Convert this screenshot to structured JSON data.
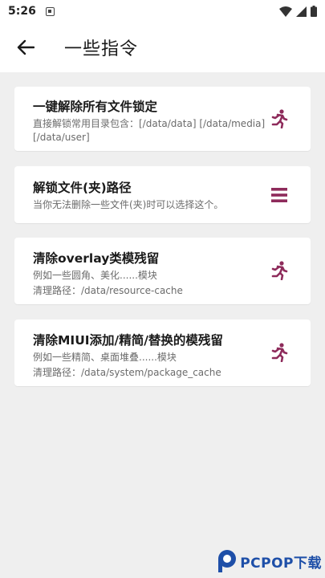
{
  "status_bar": {
    "time": "5:26",
    "notification_icon": "notification-a-icon",
    "wifi_icon": "wifi-icon",
    "signal_icon": "signal-icon",
    "battery_icon": "battery-icon"
  },
  "app_bar": {
    "back_icon": "arrow-back-icon",
    "title": "一些指令"
  },
  "accent_color": "#8e2b5b",
  "cards": [
    {
      "title": "一键解除所有文件锁定",
      "desc_lines": [
        "直接解锁常用目录包含：[/data/data] [/data/media]",
        "[/data/user]"
      ],
      "icon": "run-icon"
    },
    {
      "title": "解锁文件(夹)路径",
      "desc_lines": [
        "当你无法删除一些文件(夹)时可以选择这个。"
      ],
      "icon": "menu-icon"
    },
    {
      "title": "清除overlay类模残留",
      "desc_lines": [
        "例如一些圆角、美化......模块",
        "清理路径：/data/resource-cache"
      ],
      "icon": "run-icon"
    },
    {
      "title": "清除MIUI添加/精简/替换的模残留",
      "desc_lines": [
        "例如一些精简、桌面堆叠......模块",
        "清理路径：/data/system/package_cache"
      ],
      "icon": "run-icon"
    }
  ],
  "watermark": {
    "text": "PCPOP下载",
    "logo": "pcpop-logo"
  }
}
